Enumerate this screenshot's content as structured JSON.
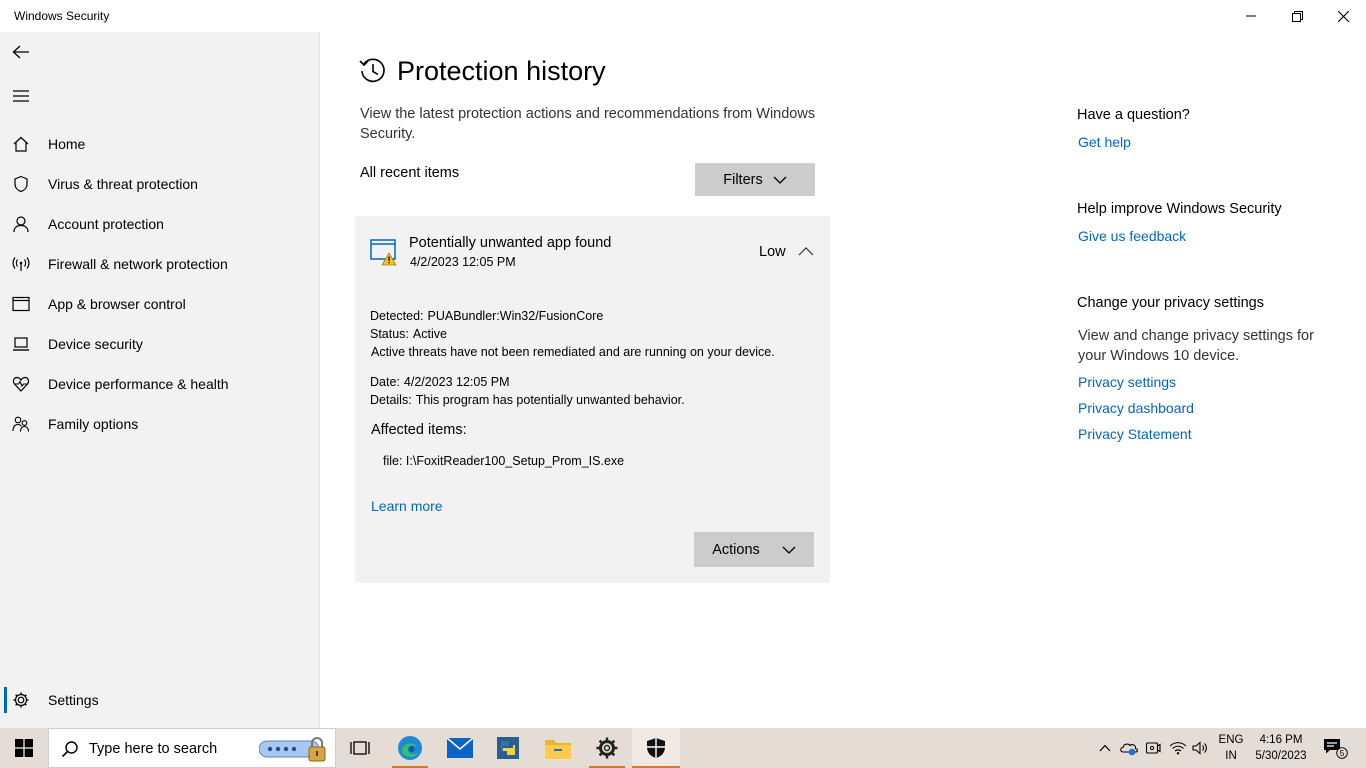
{
  "window": {
    "title": "Windows Security"
  },
  "sidebar": {
    "items": [
      {
        "label": "Home",
        "icon": "home-icon"
      },
      {
        "label": "Virus & threat protection",
        "icon": "shield-icon"
      },
      {
        "label": "Account protection",
        "icon": "person-icon"
      },
      {
        "label": "Firewall & network protection",
        "icon": "antenna-icon"
      },
      {
        "label": "App & browser control",
        "icon": "app-window-icon"
      },
      {
        "label": "Device security",
        "icon": "laptop-icon"
      },
      {
        "label": "Device performance & health",
        "icon": "heart-pulse-icon"
      },
      {
        "label": "Family options",
        "icon": "family-icon"
      }
    ],
    "settings_label": "Settings"
  },
  "main": {
    "title": "Protection history",
    "description": "View the latest protection actions and recommendations from Windows Security.",
    "recent_label": "All recent items",
    "filters_label": "Filters",
    "card": {
      "title": "Potentially unwanted app found",
      "date": "4/2/2023 12:05 PM",
      "severity": "Low",
      "detected_key": "Detected:",
      "detected_value": "PUABundler:Win32/FusionCore",
      "status_key": "Status:",
      "status_value": "Active",
      "status_note": "Active threats have not been remediated and are running on your device.",
      "date_key": "Date:",
      "date_value": "4/2/2023 12:05 PM",
      "details_key": "Details:",
      "details_value": "This program has potentially unwanted behavior.",
      "affected_label": "Affected items:",
      "file_path": "file: I:\\FoxitReader100_Setup_Prom_IS.exe",
      "learn_more": "Learn more",
      "actions_label": "Actions"
    }
  },
  "right": {
    "question_heading": "Have a question?",
    "get_help": "Get help",
    "improve_heading": "Help improve Windows Security",
    "feedback": "Give us feedback",
    "privacy_heading": "Change your privacy settings",
    "privacy_text": "View and change privacy settings for your Windows 10 device.",
    "privacy_settings": "Privacy settings",
    "privacy_dashboard": "Privacy dashboard",
    "privacy_statement": "Privacy Statement"
  },
  "taskbar": {
    "search_placeholder": "Type here to search",
    "lang_line1": "ENG",
    "lang_line2": "IN",
    "time": "4:16 PM",
    "date": "5/30/2023",
    "notification_count": "5",
    "apps": [
      "task-view-icon",
      "edge-icon",
      "mail-icon",
      "python-icon",
      "file-explorer-icon",
      "settings-gear-icon",
      "windows-security-icon"
    ]
  },
  "colors": {
    "accent": "#0067c0",
    "sidebar_bg": "#f2f2f2",
    "button_bg": "#cccccc",
    "warning": "#f5c518"
  }
}
